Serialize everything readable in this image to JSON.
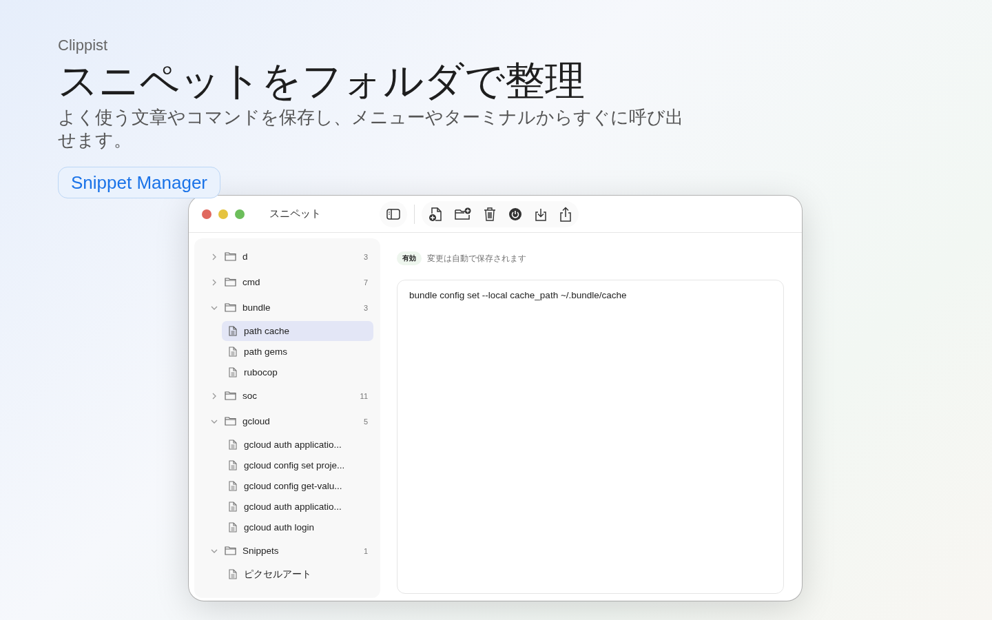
{
  "app_name": "Clippist",
  "headline": "スニペットをフォルダで整理",
  "subtitle": "よく使う文章やコマンドを保存し、メニューやターミナルからすぐに呼び出せます。",
  "badge": "Snippet Manager",
  "window": {
    "title": "スニペット"
  },
  "toolbar": [
    {
      "kind": "sidebar"
    },
    {
      "kind": "new-file"
    },
    {
      "kind": "new-folder"
    },
    {
      "kind": "trash"
    },
    {
      "kind": "power"
    },
    {
      "kind": "import"
    },
    {
      "kind": "share"
    }
  ],
  "sidebar": {
    "folders": [
      {
        "name": "d",
        "count": "3",
        "expanded": false
      },
      {
        "name": "cmd",
        "count": "7",
        "expanded": false
      },
      {
        "name": "bundle",
        "count": "3",
        "expanded": true,
        "children": [
          {
            "name": "path cache",
            "selected": true
          },
          {
            "name": "path gems",
            "selected": false
          },
          {
            "name": "rubocop",
            "selected": false
          }
        ]
      },
      {
        "name": "soc",
        "count": "11",
        "expanded": false
      },
      {
        "name": "gcloud",
        "count": "5",
        "expanded": true,
        "children": [
          {
            "name": "gcloud auth applicatio...",
            "selected": false
          },
          {
            "name": "gcloud config set proje...",
            "selected": false
          },
          {
            "name": "gcloud config get-valu...",
            "selected": false
          },
          {
            "name": "gcloud auth applicatio...",
            "selected": false
          },
          {
            "name": "gcloud auth login",
            "selected": false
          }
        ]
      },
      {
        "name": "Snippets",
        "count": "1",
        "expanded": true,
        "children": [
          {
            "name": "ピクセルアート",
            "selected": false
          }
        ]
      }
    ]
  },
  "editor": {
    "status": "有効",
    "note": "変更は自動で保存されます",
    "content": "bundle config set --local cache_path ~/.bundle/cache"
  }
}
